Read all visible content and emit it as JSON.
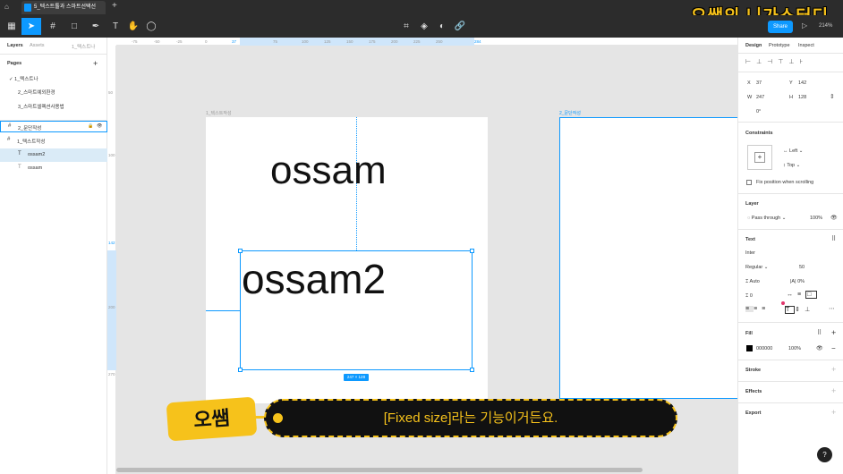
{
  "titlebar": {
    "tab_title": "5_텍스트툴과 스마트선택선",
    "brand_text": "오쌤의 니가스터디"
  },
  "toolbar": {
    "share_label": "Share",
    "zoom_label": "214%"
  },
  "left_panel": {
    "tab_layers": "Layers",
    "tab_assets": "Assets",
    "page_selector": "1_텍스트나",
    "pages_header": "Pages",
    "pages": [
      "1_텍스트나",
      "2_스마트예외환경",
      "3_스마트셀렉션사용법"
    ],
    "layers": [
      {
        "label": "2_문단작성",
        "type": "frame"
      },
      {
        "label": "1_텍스트작성",
        "type": "frame"
      },
      {
        "label": "ossam2",
        "type": "text"
      },
      {
        "label": "ossam",
        "type": "text"
      }
    ]
  },
  "ruler": {
    "h_ticks": [
      "-75",
      "-50",
      "-25",
      "0",
      "37",
      "75",
      "100",
      "125",
      "150",
      "175",
      "200",
      "225",
      "250",
      "284"
    ],
    "v_ticks": [
      "50",
      "100",
      "142",
      "200",
      "270"
    ]
  },
  "canvas": {
    "frame1_label": "1_텍스트작성",
    "frame2_label": "2_문단작성",
    "text1": "ossam",
    "text2": "ossam2",
    "size_label": "247 × 128"
  },
  "right_panel": {
    "tab_design": "Design",
    "tab_prototype": "Prototype",
    "tab_inspect": "Inspect",
    "x_label": "X",
    "x_value": "37",
    "y_label": "Y",
    "y_value": "142",
    "w_label": "W",
    "w_value": "247",
    "h_label": "H",
    "h_value": "128",
    "rotation": "0°",
    "constraints_header": "Constraints",
    "constraint_h": "Left",
    "constraint_v": "Top",
    "fix_position": "Fix position when scrolling",
    "layer_header": "Layer",
    "blend_mode": "Pass through",
    "layer_opacity": "100%",
    "text_header": "Text",
    "font_family": "Inter",
    "font_weight": "Regular",
    "font_size": "50",
    "line_height": "Auto",
    "letter_spacing": "0%",
    "paragraph_spacing": "0",
    "fill_header": "Fill",
    "fill_hex": "000000",
    "fill_opacity": "100%",
    "stroke_header": "Stroke",
    "effects_header": "Effects",
    "export_header": "Export"
  },
  "subtitle": {
    "speaker": "오쌤",
    "text": "[Fixed size]라는 기능이거든요."
  },
  "colors": {
    "accent": "#0d99ff",
    "dark_ui": "#2c2c2c",
    "subtitle_yellow": "#f6c21b"
  }
}
